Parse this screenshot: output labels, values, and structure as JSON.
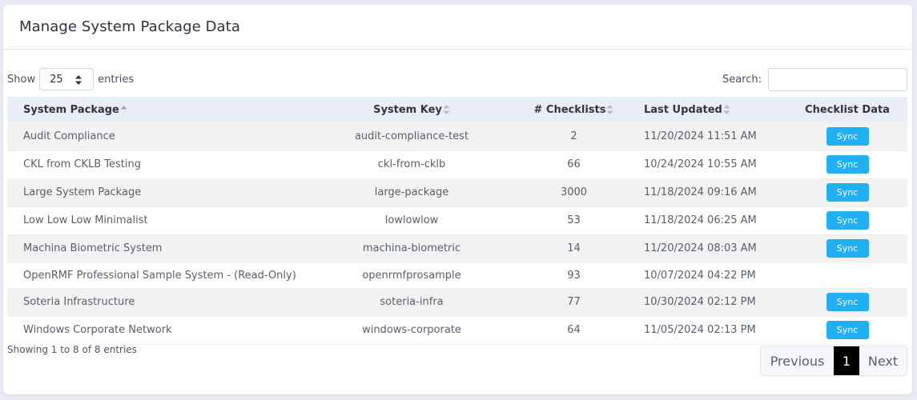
{
  "title": "Manage System Package Data",
  "length_control": {
    "prefix": "Show",
    "value": "25",
    "suffix": "entries"
  },
  "search": {
    "label": "Search:",
    "value": ""
  },
  "columns": [
    "System Package",
    "System Key",
    "# Checklists",
    "Last Updated",
    "Checklist Data"
  ],
  "rows": [
    {
      "package": "Audit Compliance",
      "key": "audit-compliance-test",
      "checklists": "2",
      "updated": "11/20/2024 11:51 AM",
      "action": "Sync"
    },
    {
      "package": "CKL from CKLB Testing",
      "key": "ckl-from-cklb",
      "checklists": "66",
      "updated": "10/24/2024 10:55 AM",
      "action": "Sync"
    },
    {
      "package": "Large System Package",
      "key": "large-package",
      "checklists": "3000",
      "updated": "11/18/2024 09:16 AM",
      "action": "Sync"
    },
    {
      "package": "Low Low Low Minimalist",
      "key": "lowlowlow",
      "checklists": "53",
      "updated": "11/18/2024 06:25 AM",
      "action": "Sync"
    },
    {
      "package": "Machina Biometric System",
      "key": "machina-biometric",
      "checklists": "14",
      "updated": "11/20/2024 08:03 AM",
      "action": "Sync"
    },
    {
      "package": "OpenRMF Professional Sample System - (Read-Only)",
      "key": "openrmfprosample",
      "checklists": "93",
      "updated": "10/07/2024 04:22 PM",
      "action": ""
    },
    {
      "package": "Soteria Infrastructure",
      "key": "soteria-infra",
      "checklists": "77",
      "updated": "10/30/2024 02:12 PM",
      "action": "Sync"
    },
    {
      "package": "Windows Corporate Network",
      "key": "windows-corporate",
      "checklists": "64",
      "updated": "11/05/2024 02:13 PM",
      "action": "Sync"
    }
  ],
  "info": "Showing 1 to 8 of 8 entries",
  "pagination": {
    "previous": "Previous",
    "current": "1",
    "next": "Next"
  },
  "colors": {
    "accent": "#22b0f5",
    "header_bg": "#e9edf5",
    "stripe": "#f2f2f2"
  }
}
